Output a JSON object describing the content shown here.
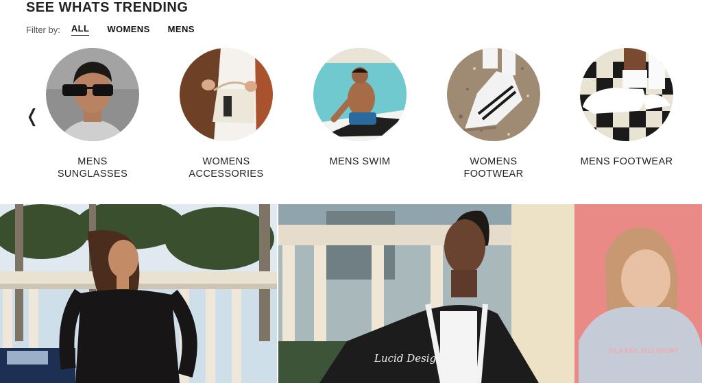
{
  "section": {
    "title": "SEE WHATS TRENDING",
    "filter_label": "Filter by:",
    "filters": [
      "ALL",
      "WOMENS",
      "MENS"
    ],
    "active_filter": "ALL"
  },
  "carousel": {
    "prev_icon": "chevron-left-icon",
    "prev_glyph": "❬",
    "categories": [
      {
        "label": "MENS SUNGLASSES"
      },
      {
        "label": "WOMENS ACCESSORIES"
      },
      {
        "label": "MENS SWIM"
      },
      {
        "label": "WOMENS FOOTWEAR"
      },
      {
        "label": "MENS FOOTWEAR"
      }
    ]
  },
  "banners": {
    "left_alt": "woman in off-shoulder black top by pillars",
    "center_alt": "man in varsity jacket",
    "center_jacket_text": "Lucid Designs",
    "right_alt": "girl in grey hoodie",
    "right_hoodie_text": "FILA EST. 1911 SPORT"
  },
  "colors": {
    "text": "#222222",
    "pink_wall": "#e98a86"
  }
}
